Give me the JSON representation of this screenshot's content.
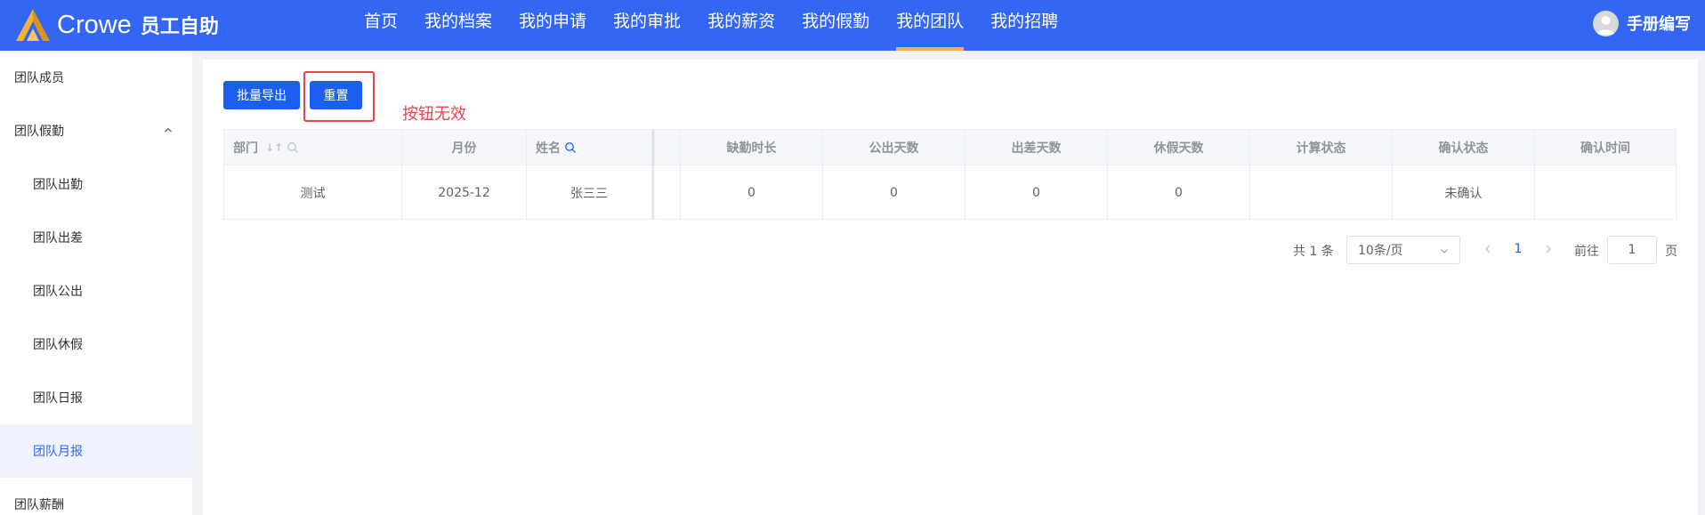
{
  "header": {
    "logo_text": "Crowe",
    "logo_sub": "员工自助",
    "nav": [
      "首页",
      "我的档案",
      "我的申请",
      "我的审批",
      "我的薪资",
      "我的假勤",
      "我的团队",
      "我的招聘"
    ],
    "active_nav": "我的团队",
    "user_name": "手册编写",
    "accent": "#3366f3",
    "active_underline": "#f3b13a"
  },
  "sidebar": {
    "items": [
      {
        "label": "团队成员",
        "type": "top"
      },
      {
        "label": "团队假勤",
        "type": "group",
        "expanded": true
      },
      {
        "label": "团队出勤",
        "type": "sub"
      },
      {
        "label": "团队出差",
        "type": "sub"
      },
      {
        "label": "团队公出",
        "type": "sub"
      },
      {
        "label": "团队休假",
        "type": "sub"
      },
      {
        "label": "团队日报",
        "type": "sub"
      },
      {
        "label": "团队月报",
        "type": "sub",
        "active": true
      },
      {
        "label": "团队薪酬",
        "type": "top"
      }
    ]
  },
  "toolbar": {
    "export_label": "批量导出",
    "reset_label": "重置",
    "annotation": "按钮无效"
  },
  "table": {
    "columns": [
      "部门",
      "月份",
      "姓名",
      "缺勤时长",
      "公出天数",
      "出差天数",
      "休假天数",
      "计算状态",
      "确认状态",
      "确认时间"
    ],
    "rows": [
      [
        "测试",
        "2025-12",
        "张三三",
        "0",
        "0",
        "0",
        "0",
        "",
        "未确认",
        ""
      ]
    ]
  },
  "pagination": {
    "total": "共 1 条",
    "page_size": "10条/页",
    "current": "1",
    "goto_label": "前往",
    "goto_value": "1",
    "page_label": "页"
  }
}
